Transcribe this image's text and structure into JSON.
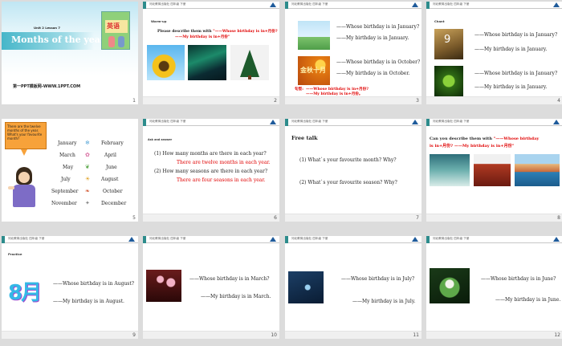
{
  "header": {
    "publisher": "河北教育出版社",
    "grade": "四年级",
    "term": "下册"
  },
  "slides": [
    {
      "num": "1",
      "unit": "Unit 2 Lesson 7",
      "title": "Months of the year.",
      "book": "英语",
      "watermark": "第一PPT模板网-WWW.1PPT.COM"
    },
    {
      "num": "2",
      "label": "Warm-up",
      "prompt_a": "Please describe them with",
      "prompt_b": "\"——Whose birthday is in+月份?",
      "prompt_c": "——My birthday is in+月份\""
    },
    {
      "num": "3",
      "q1": "——Whose birthday is in January?",
      "a1": "——My birthday is in January.",
      "q2": "——Whose birthday is in October?",
      "a2": "——My birthday is in October.",
      "img2_text": "金秋十月",
      "pattern_label": "句型:",
      "pattern_q": "——Whose birthday is in+月份?",
      "pattern_a": "——My birthday is in+月份。"
    },
    {
      "num": "4",
      "label": "Chant",
      "q1": "——Whose birthday is in January?",
      "a1": "——My birthday is in January.",
      "q2": "——Whose birthday is in January?",
      "a2": "——My birthday is in January.",
      "img_num": "9"
    },
    {
      "num": "5",
      "bubble": "There are the twelve months of the year. What's your favourite month?",
      "months": [
        "January",
        "February",
        "March",
        "April",
        "May",
        "June",
        "July",
        "August",
        "September",
        "October",
        "November",
        "December"
      ]
    },
    {
      "num": "6",
      "label": "Ask and answer",
      "q1": "(1) How many months are there in each year?",
      "a1": "There are twelve months in each year.",
      "q2": "(2) How many seasons are there in each year?",
      "a2": "There are four seasons in each year."
    },
    {
      "num": "7",
      "label": "Free talk",
      "q1": "(1) What`s your favourite month? Why?",
      "q2": "(2) What`s your favourite season? Why?"
    },
    {
      "num": "8",
      "prompt_a": "Can you describe them with",
      "prompt_b": "\"——Whose birthday",
      "prompt_c": "is in+月份? ——My birthday is in+月份\""
    },
    {
      "num": "9",
      "label": "Practice",
      "q": "——Whose birthday is in August?",
      "a": "——My birthday is in August.",
      "img_text": "8月"
    },
    {
      "num": "10",
      "q": "——Whose birthday is in March?",
      "a": "——My birthday is in March."
    },
    {
      "num": "11",
      "q": "——Whose birthday is in July?",
      "a": "——My birthday is in July."
    },
    {
      "num": "12",
      "q": "——Whose birthday is in June?",
      "a": "——My birthday is in June."
    }
  ],
  "colors": {
    "teal": "#2d8c8c",
    "red": "#e00000",
    "background": "#dcdcdc"
  }
}
